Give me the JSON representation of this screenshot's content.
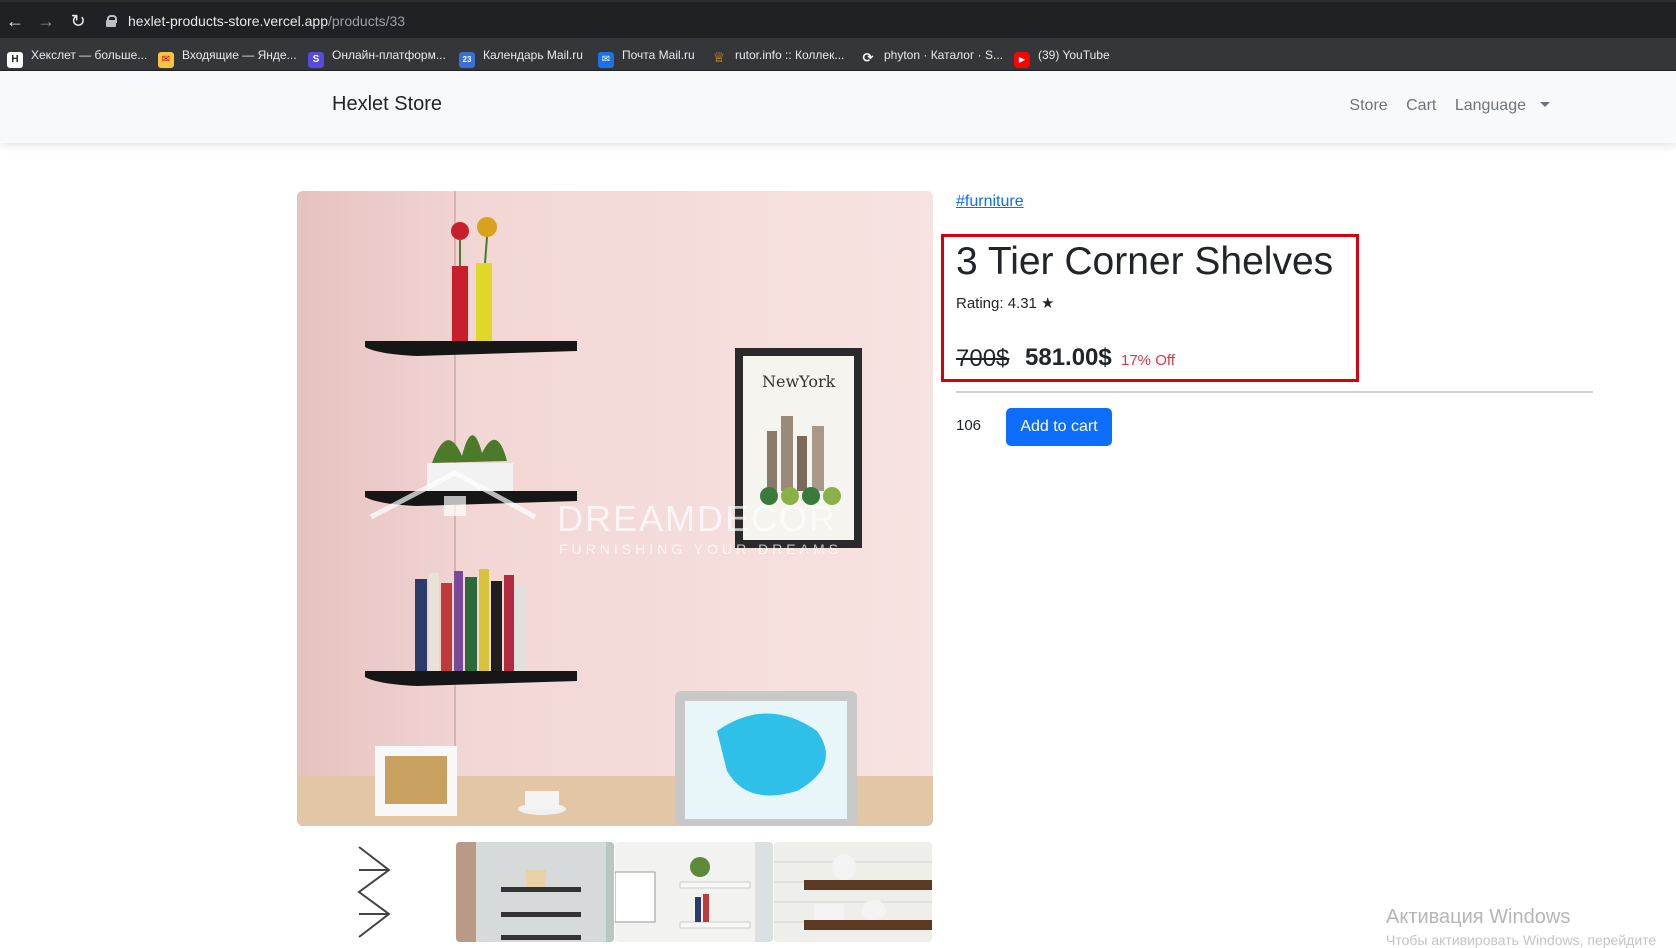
{
  "browser": {
    "url_host": "hexlet-products-store.vercel.app",
    "url_path": "/products/33",
    "bookmarks": [
      {
        "label": "Хекслет — больше...",
        "icon": "hexlet-icon",
        "color": "#ffffff"
      },
      {
        "label": "Входящие — Янде...",
        "icon": "mail-envelope-icon",
        "color": "#f5c542"
      },
      {
        "label": "Онлайн-платформ...",
        "icon": "platform-s-icon",
        "color": "#5b4bdb"
      },
      {
        "label": "Календарь Mail.ru",
        "icon": "calendar-icon",
        "color": "#3b6fd8"
      },
      {
        "label": "Почта Mail.ru",
        "icon": "mailru-icon",
        "color": "#1a73e8"
      },
      {
        "label": "rutor.info :: Коллек...",
        "icon": "rutor-icon",
        "color": "#e8a020"
      },
      {
        "label": "phyton · Каталог · S...",
        "icon": "stepik-icon",
        "color": "#ffffff"
      },
      {
        "label": "(39) YouTube",
        "icon": "youtube-icon",
        "color": "#ff0000"
      }
    ]
  },
  "navbar": {
    "brand": "Hexlet Store",
    "links": {
      "store": "Store",
      "cart": "Cart",
      "language": "Language"
    }
  },
  "product": {
    "tag": "#furniture",
    "title": "3 Tier Corner Shelves",
    "rating": "Rating: 4.31 ★",
    "old_price": "700$",
    "price": "581.00$",
    "discount": "17% Off",
    "quantity": "106",
    "add_to_cart": "Add to cart",
    "watermark_brand": "DREAMDECOR",
    "watermark_tagline": "FURNISHING YOUR DREAMS",
    "poster_text": "NewYork"
  },
  "os": {
    "activation_title": "Активация Windows",
    "activation_sub": "Чтобы активировать Windows, перейдите"
  },
  "colors": {
    "primary": "#0d6efd",
    "discount": "#dc3545",
    "highlight": "#d9000e"
  }
}
